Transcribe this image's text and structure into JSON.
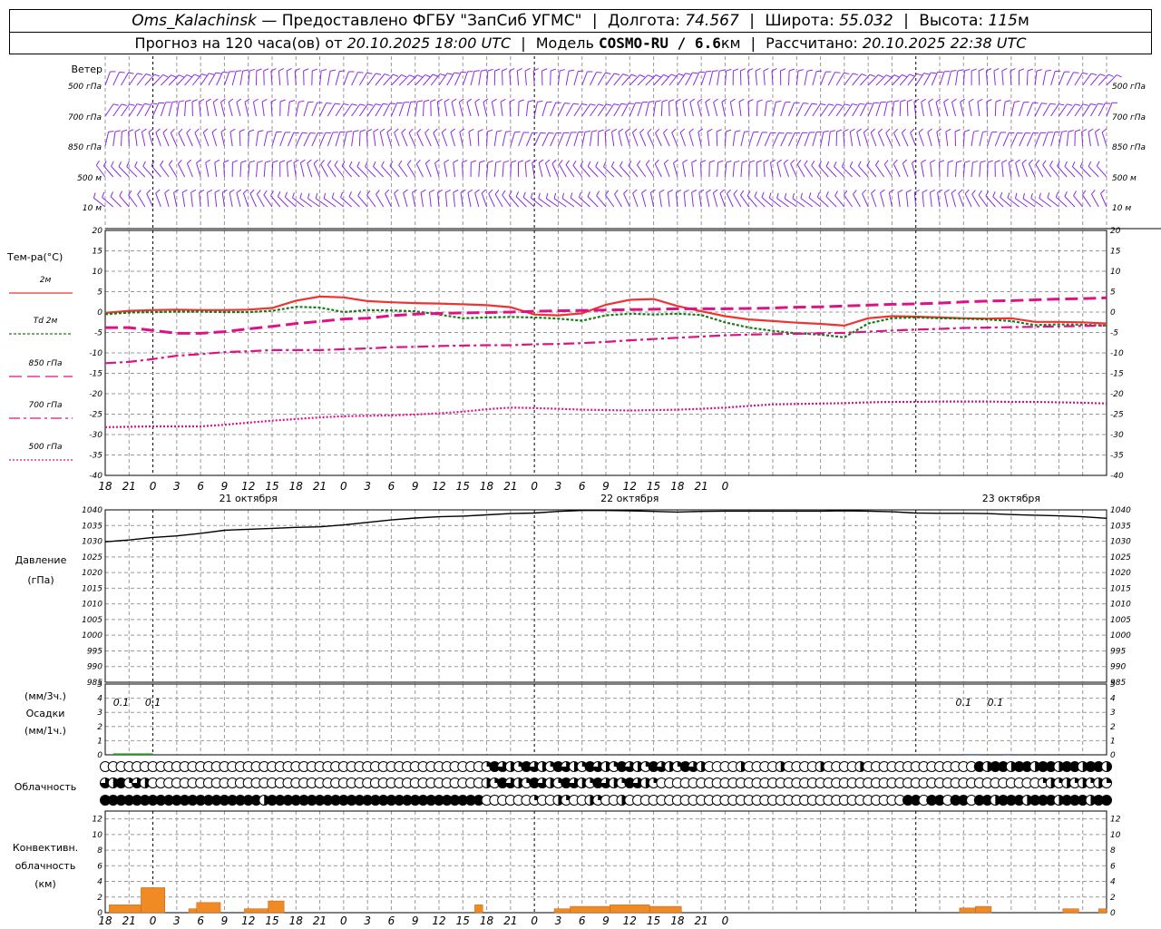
{
  "header": {
    "station": "Oms_Kalachinsk",
    "dash": "—",
    "provider": "Предоставлено ФГБУ \"ЗапСиб УГМС\"",
    "lon_label": "Долгота:",
    "lon_value": "74.567",
    "lat_label": "Широта:",
    "lat_value": "55.032",
    "alt_label": "Высота:",
    "alt_value": "115",
    "alt_unit": "м",
    "forecast_label": "Прогноз на 120 часа(ов) от",
    "forecast_start": "20.10.2025 18:00 UTC",
    "model_label": "Модель",
    "model_name": "COSMO-RU / 6.6",
    "model_unit": "км",
    "calc_label": "Рассчитано:",
    "calc_time": "20.10.2025 22:38 UTC"
  },
  "colors": {
    "wind": "#8a2be2",
    "t2m": "#ee3333",
    "td2m": "#1a7a1a",
    "t850": "#dd1188",
    "t700": "#dd1188",
    "t500": "#dd1188",
    "pressure": "#000000",
    "precip": "#1a9a1a",
    "convective": "#f08a24",
    "grid": "#999999"
  },
  "wind_panel": {
    "title": "Ветер",
    "levels": [
      "500 гПа",
      "700 гПа",
      "850 гПа",
      "500 м",
      "10  м"
    ]
  },
  "time_axis": {
    "hour_labels": [
      "18",
      "21",
      "0",
      "3",
      "6",
      "9",
      "12",
      "15",
      "18",
      "21",
      "0",
      "3",
      "6",
      "9",
      "12",
      "15",
      "18",
      "21",
      "0",
      "3",
      "6",
      "9",
      "12",
      "15",
      "18",
      "21",
      "0"
    ],
    "date_labels": [
      "21 октября",
      "22 октября",
      "23 октября"
    ]
  },
  "chart_data": [
    {
      "type": "line",
      "title": "Тем-ра(°С)",
      "x_hours": [
        0,
        3,
        6,
        9,
        12,
        15,
        18,
        21,
        24,
        27,
        30,
        33,
        36,
        39,
        42,
        45,
        48,
        51,
        54,
        57,
        60,
        63,
        66,
        69,
        72,
        75,
        78,
        81,
        84,
        87,
        90,
        93,
        96,
        99,
        102,
        105,
        108,
        111,
        114,
        117,
        120,
        123,
        126
      ],
      "ylim": [
        -40,
        20
      ],
      "yticks": [
        20,
        15,
        10,
        5,
        0,
        -5,
        -10,
        -15,
        -20,
        -25,
        -30,
        -35,
        -40
      ],
      "series": [
        {
          "name": "2м",
          "style": "solid",
          "values": [
            -0.2,
            0.3,
            0.5,
            0.6,
            0.5,
            0.5,
            0.6,
            1.0,
            2.8,
            3.8,
            3.6,
            2.7,
            2.4,
            2.2,
            2.1,
            1.9,
            1.7,
            1.2,
            -0.6,
            -0.8,
            -0.3,
            1.8,
            3.0,
            3.2,
            1.5,
            0.2,
            -1.0,
            -1.8,
            -2.2,
            -2.6,
            -2.9,
            -3.3,
            -1.5,
            -1.0,
            -1.1,
            -1.3,
            -1.5,
            -1.6,
            -1.5,
            -2.4,
            -2.4,
            -2.5,
            -2.8
          ]
        },
        {
          "name": "Td  2м",
          "style": "dotted",
          "values": [
            -0.5,
            -0.1,
            0.0,
            0.1,
            0.1,
            0.0,
            0.0,
            0.3,
            1.3,
            1.1,
            0.0,
            0.5,
            0.4,
            0.2,
            -0.6,
            -1.5,
            -1.3,
            -1.2,
            -1.3,
            -1.6,
            -2.1,
            -0.8,
            -0.4,
            -0.6,
            -0.4,
            -0.7,
            -2.5,
            -3.8,
            -4.6,
            -5.2,
            -5.5,
            -6.2,
            -2.8,
            -1.5,
            -1.3,
            -1.5,
            -1.6,
            -1.8,
            -2.2,
            -3.2,
            -3.0,
            -3.1,
            -3.3
          ]
        },
        {
          "name": "850 гПа",
          "style": "dashed",
          "values": [
            -3.8,
            -3.8,
            -4.5,
            -5.2,
            -5.2,
            -4.8,
            -4.1,
            -3.5,
            -2.8,
            -2.3,
            -1.7,
            -1.5,
            -0.9,
            -0.5,
            -0.3,
            -0.2,
            -0.1,
            0.0,
            0.2,
            0.3,
            0.4,
            0.5,
            0.6,
            0.7,
            0.8,
            0.8,
            0.8,
            0.9,
            1.0,
            1.2,
            1.3,
            1.5,
            1.7,
            1.9,
            2.0,
            2.2,
            2.5,
            2.7,
            2.8,
            3.0,
            3.2,
            3.3,
            3.5
          ]
        },
        {
          "name": "700 гПа",
          "style": "dashdot",
          "values": [
            -12.5,
            -12.2,
            -11.5,
            -10.7,
            -10.3,
            -9.8,
            -9.6,
            -9.3,
            -9.3,
            -9.3,
            -9.1,
            -8.9,
            -8.6,
            -8.5,
            -8.3,
            -8.2,
            -8.1,
            -8.1,
            -7.9,
            -7.8,
            -7.6,
            -7.3,
            -6.9,
            -6.6,
            -6.3,
            -6.0,
            -5.7,
            -5.5,
            -5.4,
            -5.3,
            -5.2,
            -5.1,
            -4.8,
            -4.5,
            -4.3,
            -4.1,
            -3.9,
            -3.8,
            -3.7,
            -3.6,
            -3.5,
            -3.4,
            -3.3
          ]
        },
        {
          "name": "500 гПа",
          "style": "dotted",
          "values": [
            -28.2,
            -28.1,
            -28.0,
            -28.0,
            -28.0,
            -27.6,
            -27.1,
            -26.6,
            -26.2,
            -25.8,
            -25.5,
            -25.4,
            -25.3,
            -25.1,
            -24.8,
            -24.4,
            -23.8,
            -23.4,
            -23.5,
            -23.7,
            -23.9,
            -24.0,
            -24.1,
            -24.0,
            -23.9,
            -23.7,
            -23.4,
            -23.0,
            -22.6,
            -22.5,
            -22.4,
            -22.3,
            -22.1,
            -22.0,
            -22.0,
            -21.9,
            -21.9,
            -21.9,
            -22.0,
            -22.0,
            -22.1,
            -22.2,
            -22.4
          ]
        }
      ]
    },
    {
      "type": "line",
      "title": "Давление",
      "ylabel": "(гПа)",
      "ylim": [
        985,
        1040
      ],
      "yticks": [
        1040,
        1035,
        1030,
        1025,
        1020,
        1015,
        1010,
        1005,
        1000,
        995,
        990,
        985
      ],
      "x_hours": [
        0,
        3,
        6,
        9,
        12,
        15,
        18,
        21,
        24,
        27,
        30,
        33,
        36,
        39,
        42,
        45,
        48,
        51,
        54,
        57,
        60,
        63,
        66,
        69,
        72,
        75,
        78,
        81,
        84,
        87,
        90,
        93,
        96,
        99,
        102,
        105,
        108,
        111,
        114,
        117,
        120,
        123,
        126
      ],
      "series": [
        {
          "name": "",
          "values": [
            1029.8,
            1030.4,
            1031.2,
            1031.7,
            1032.5,
            1033.5,
            1033.8,
            1034.1,
            1034.4,
            1034.6,
            1035.2,
            1036.0,
            1036.8,
            1037.4,
            1037.8,
            1038.0,
            1038.4,
            1038.8,
            1039.0,
            1039.5,
            1039.8,
            1039.8,
            1039.7,
            1039.5,
            1039.3,
            1039.5,
            1039.6,
            1039.6,
            1039.6,
            1039.6,
            1039.6,
            1039.7,
            1039.6,
            1039.4,
            1039.0,
            1038.9,
            1038.9,
            1038.8,
            1038.5,
            1038.3,
            1038.1,
            1037.8,
            1037.3
          ]
        }
      ]
    },
    {
      "type": "bar",
      "title": "Осадки",
      "ylabel_top": "(мм/3ч.)",
      "ylabel_bottom": "(мм/1ч.)",
      "ylim": [
        0,
        5
      ],
      "yticks": [
        5,
        4,
        3,
        2,
        1,
        0
      ],
      "annotations": [
        {
          "hour": 2,
          "text": "0.1"
        },
        {
          "hour": 6,
          "text": "0.1"
        },
        {
          "hour": 108,
          "text": "0.1"
        },
        {
          "hour": 112,
          "text": "0.1"
        }
      ],
      "bars": [
        {
          "hour_start": 1,
          "hour_end": 5,
          "value": 0.1
        },
        {
          "hour_start": 5,
          "hour_end": 6,
          "value": 0.1
        },
        {
          "hour_start": 108,
          "hour_end": 110,
          "value": 0.05
        },
        {
          "hour_start": 113,
          "hour_end": 114,
          "value": 0.05
        }
      ]
    },
    {
      "type": "heatmap",
      "title": "Облачность",
      "rows": 3,
      "note": "cloud cover octas per hour; circles filled by fraction"
    },
    {
      "type": "bar",
      "title": "Конвективн. облачность (км)",
      "ylabel_lines": [
        "Конвективн.",
        "облачность",
        "(км)"
      ],
      "ylim": [
        0,
        13
      ],
      "yticks": [
        12,
        10,
        8,
        6,
        4,
        2,
        0
      ],
      "bars": [
        {
          "hour_start": 0.5,
          "hour_end": 4.5,
          "value": 1.0
        },
        {
          "hour_start": 4.5,
          "hour_end": 7.5,
          "value": 3.2
        },
        {
          "hour_start": 10.5,
          "hour_end": 11.5,
          "value": 0.5
        },
        {
          "hour_start": 11.5,
          "hour_end": 14.5,
          "value": 1.3
        },
        {
          "hour_start": 17.5,
          "hour_end": 20.5,
          "value": 0.5
        },
        {
          "hour_start": 20.5,
          "hour_end": 22.5,
          "value": 1.5
        },
        {
          "hour_start": 46.5,
          "hour_end": 47.5,
          "value": 1.0
        },
        {
          "hour_start": 56.5,
          "hour_end": 58.5,
          "value": 0.5
        },
        {
          "hour_start": 58.5,
          "hour_end": 63.5,
          "value": 0.8
        },
        {
          "hour_start": 63.5,
          "hour_end": 68.5,
          "value": 1.0
        },
        {
          "hour_start": 68.5,
          "hour_end": 72.5,
          "value": 0.8
        },
        {
          "hour_start": 107.5,
          "hour_end": 109.5,
          "value": 0.6
        },
        {
          "hour_start": 109.5,
          "hour_end": 111.5,
          "value": 0.8
        },
        {
          "hour_start": 120.5,
          "hour_end": 122.5,
          "value": 0.5
        },
        {
          "hour_start": 125,
          "hour_end": 126,
          "value": 0.5
        }
      ]
    }
  ]
}
